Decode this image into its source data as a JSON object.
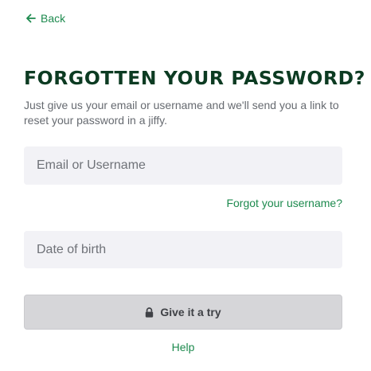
{
  "nav": {
    "back_label": "Back",
    "back_icon": "arrow-left-icon"
  },
  "heading": {
    "title": "FORGOTTEN YOUR PASSWORD?",
    "subtitle": "Just give us your email or username and we'll send you a link to reset your password in a jiffy."
  },
  "form": {
    "email_placeholder": "Email or Username",
    "email_value": "",
    "forgot_username_label": "Forgot your username?",
    "dob_placeholder": "Date of birth",
    "dob_value": "",
    "submit_label": "Give it a try",
    "submit_icon": "lock-icon",
    "help_label": "Help"
  },
  "colors": {
    "accent_green": "#1d8a4e",
    "title_dark_green": "#0c3b22",
    "input_background": "#f2f2f6",
    "button_disabled": "#d6d6d9"
  }
}
